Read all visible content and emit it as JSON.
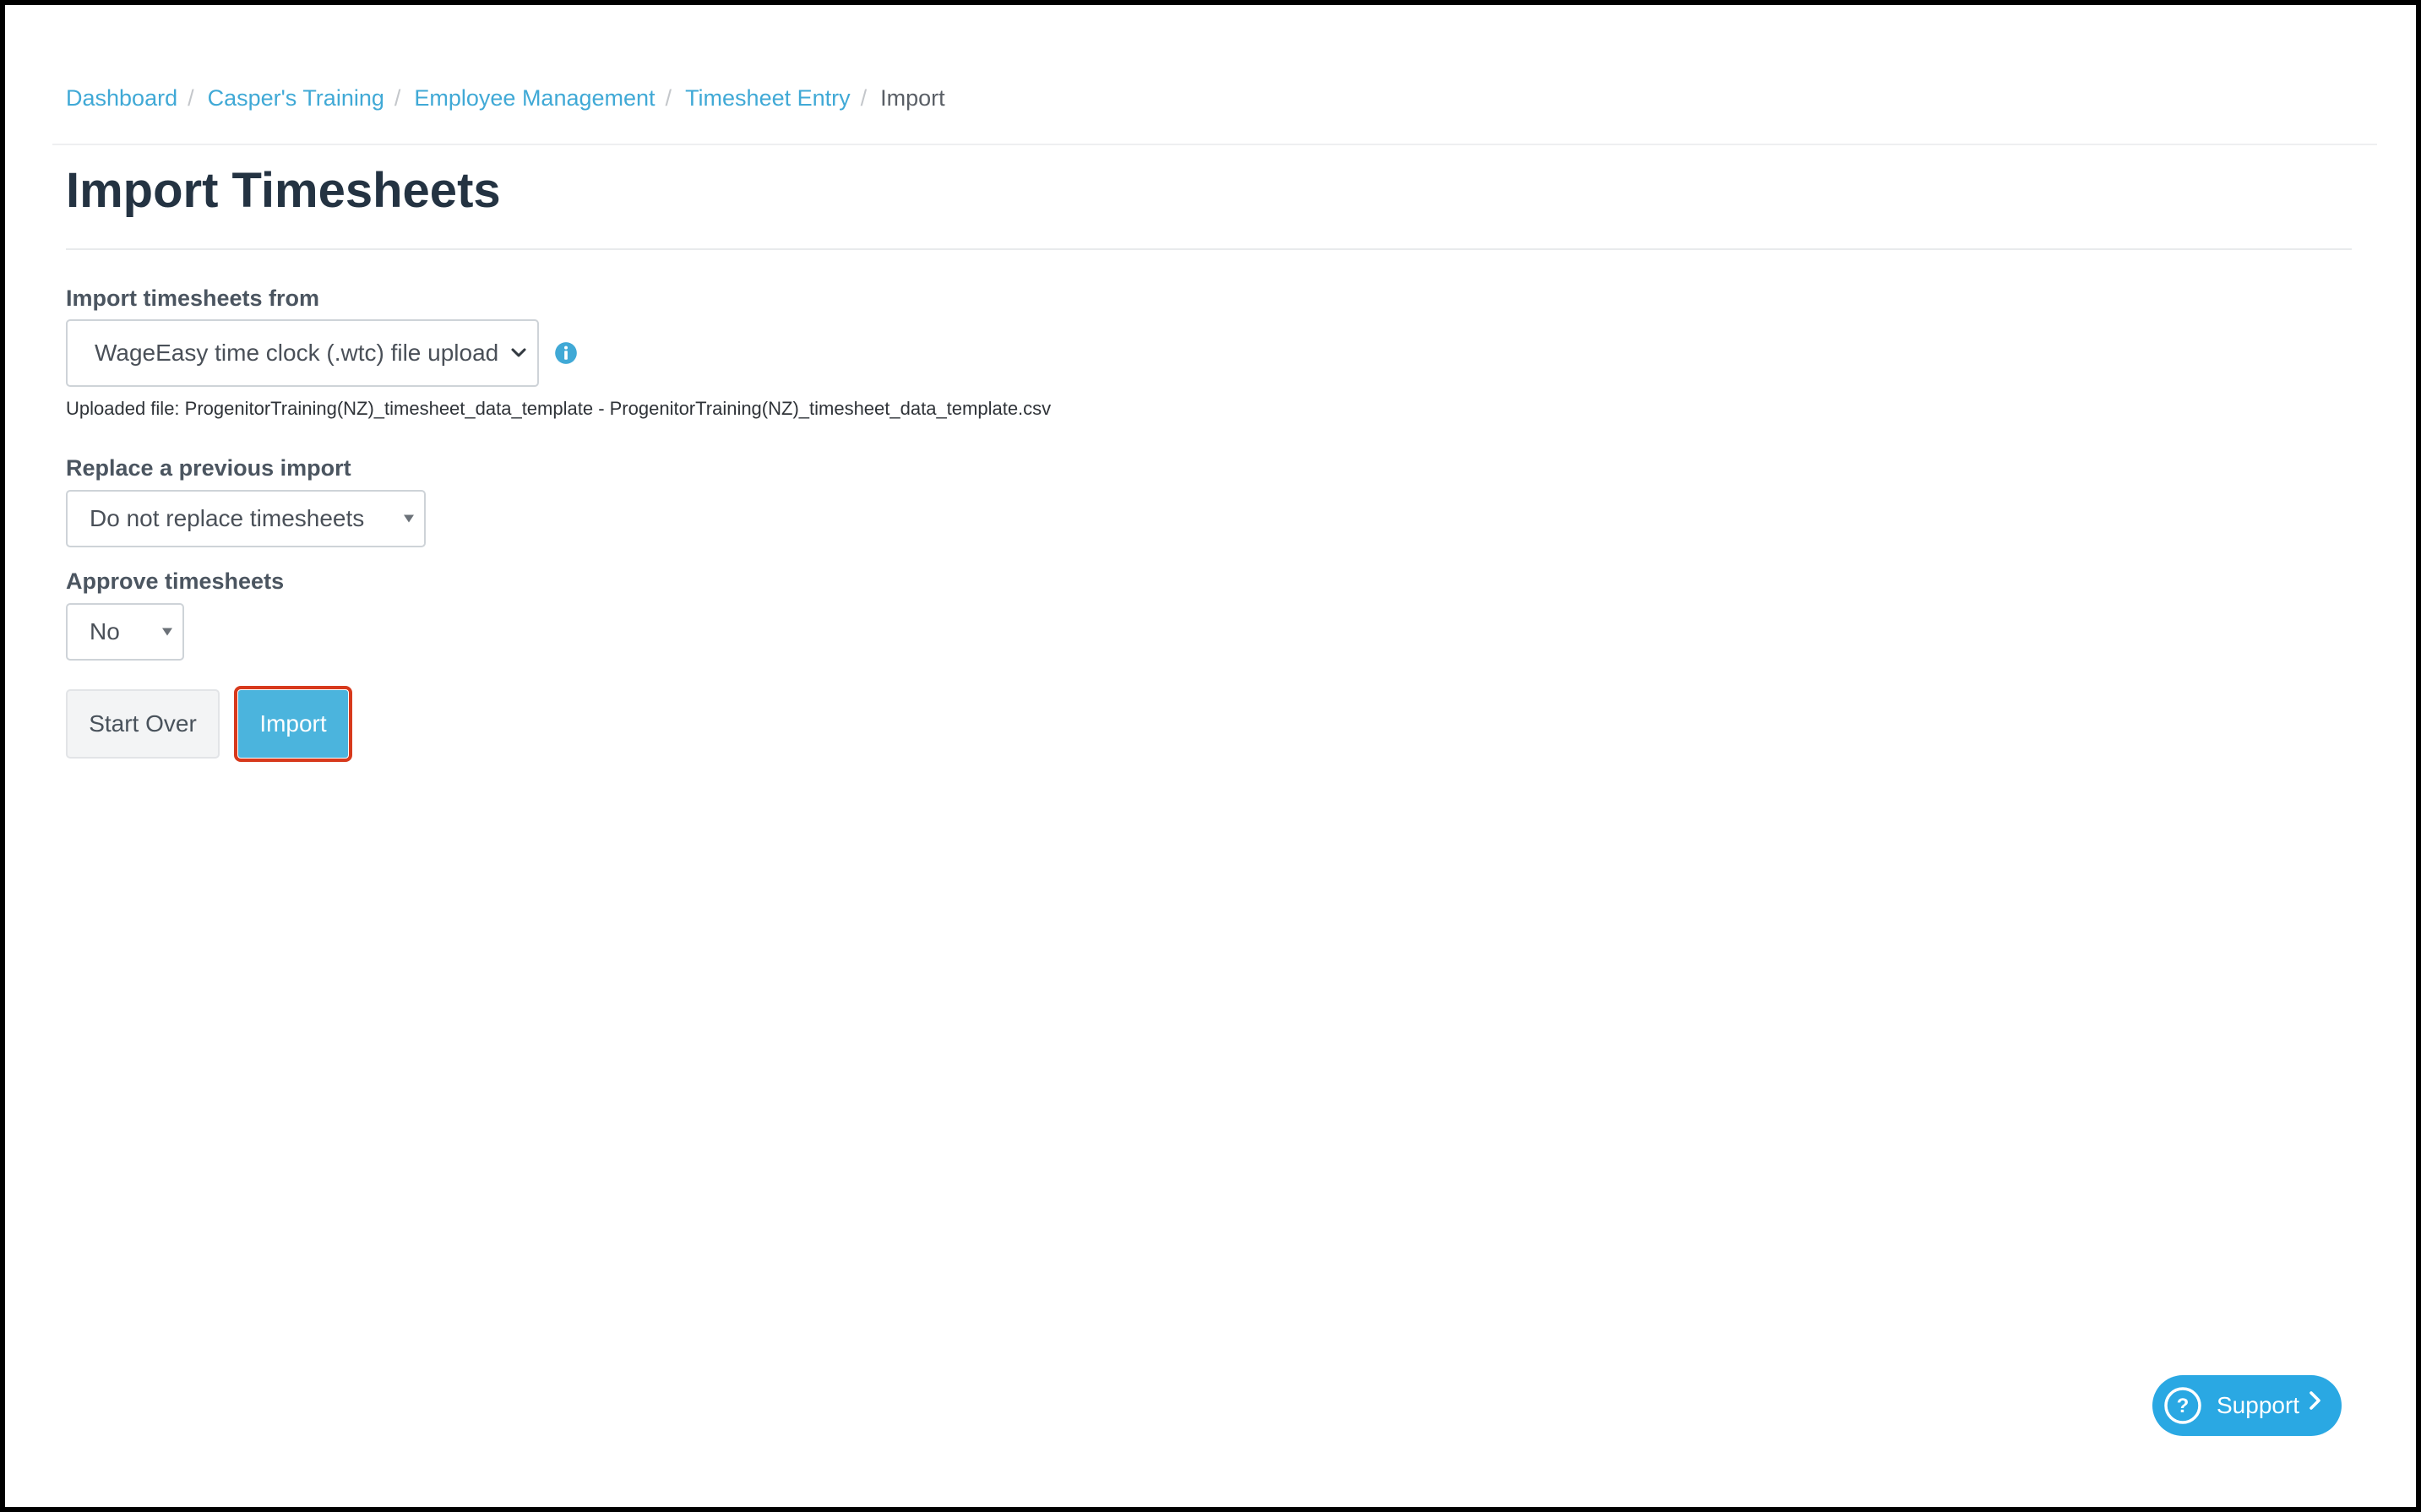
{
  "breadcrumb": {
    "items": [
      "Dashboard",
      "Casper's Training",
      "Employee Management",
      "Timesheet Entry"
    ],
    "current": "Import",
    "separator": "/"
  },
  "page": {
    "title": "Import Timesheets"
  },
  "form": {
    "source": {
      "label": "Import timesheets from",
      "selected": "WageEasy time clock (.wtc) file upload",
      "info_icon": "info-circle-icon"
    },
    "uploaded_file": "Uploaded file: ProgenitorTraining(NZ)_timesheet_data_template - ProgenitorTraining(NZ)_timesheet_data_template.csv",
    "replace": {
      "label": "Replace a previous import",
      "selected": "Do not replace timesheets"
    },
    "approve": {
      "label": "Approve timesheets",
      "selected": "No"
    },
    "buttons": {
      "start_over": "Start Over",
      "import": "Import"
    }
  },
  "support": {
    "label": "Support",
    "icon": "question-circle-icon"
  },
  "colors": {
    "link": "#40a9d6",
    "primary_button": "#4bb4dd",
    "highlight_outline": "#d7391c",
    "support": "#2aa8e3",
    "title": "#243342"
  }
}
